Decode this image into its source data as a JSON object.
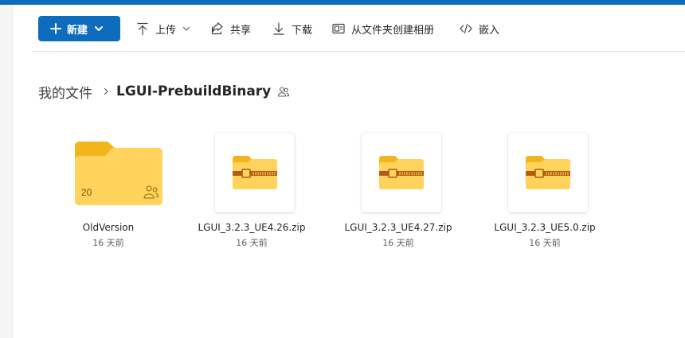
{
  "command_bar": {
    "new_label": "新建",
    "upload_label": "上传",
    "share_label": "共享",
    "download_label": "下载",
    "create_album_label": "从文件夹创建相册",
    "embed_label": "嵌入"
  },
  "breadcrumb": {
    "root": "我的文件",
    "current": "LGUI-PrebuildBinary"
  },
  "items": [
    {
      "name": "OldVersion",
      "date": "16 天前",
      "type": "folder",
      "count": "20",
      "shared": true
    },
    {
      "name": "LGUI_3.2.3_UE4.26.zip",
      "date": "16 天前",
      "type": "zip"
    },
    {
      "name": "LGUI_3.2.3_UE4.27.zip",
      "date": "16 天前",
      "type": "zip"
    },
    {
      "name": "LGUI_3.2.3_UE5.0.zip",
      "date": "16 天前",
      "type": "zip"
    }
  ],
  "colors": {
    "accent": "#0f6cbd",
    "folder_front": "#ffd35c",
    "folder_back": "#f3b51c",
    "zipper": "#b35b12"
  }
}
